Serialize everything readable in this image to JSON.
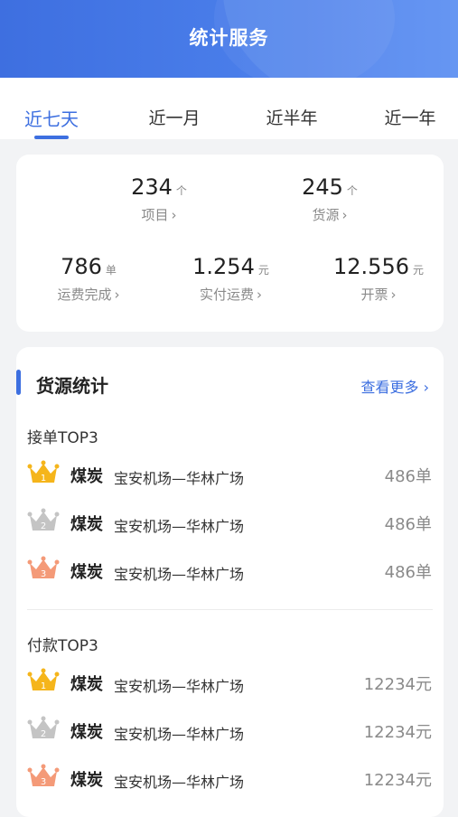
{
  "header": {
    "title": "统计服务"
  },
  "tabs": [
    {
      "label": "近七天",
      "active": true
    },
    {
      "label": "近一月",
      "active": false
    },
    {
      "label": "近半年",
      "active": false
    },
    {
      "label": "近一年",
      "active": false
    }
  ],
  "stats": {
    "projects": {
      "value": "234",
      "unit": "个",
      "label": "项目",
      "chevron": "›"
    },
    "sources": {
      "value": "245",
      "unit": "个",
      "label": "货源",
      "chevron": "›"
    },
    "freight_done": {
      "value": "786",
      "unit": "单",
      "label": "运费完成",
      "chevron": "›"
    },
    "paid_freight": {
      "value": "1.254",
      "unit": "元",
      "label": "实付运费",
      "chevron": "›"
    },
    "invoice": {
      "value": "12.556",
      "unit": "元",
      "label": "开票",
      "chevron": "›"
    }
  },
  "goods_stats": {
    "title": "货源统计",
    "more_label": "查看更多",
    "more_chevron": "›",
    "order_top": {
      "title": "接单TOP3",
      "rows": [
        {
          "rank": "1",
          "cargo": "煤炭",
          "route": "宝安机场—华林广场",
          "value": "486单"
        },
        {
          "rank": "2",
          "cargo": "煤炭",
          "route": "宝安机场—华林广场",
          "value": "486单"
        },
        {
          "rank": "3",
          "cargo": "煤炭",
          "route": "宝安机场—华林广场",
          "value": "486单"
        }
      ]
    },
    "payment_top": {
      "title": "付款TOP3",
      "rows": [
        {
          "rank": "1",
          "cargo": "煤炭",
          "route": "宝安机场—华林广场",
          "value": "12234元"
        },
        {
          "rank": "2",
          "cargo": "煤炭",
          "route": "宝安机场—华林广场",
          "value": "12234元"
        },
        {
          "rank": "3",
          "cargo": "煤炭",
          "route": "宝安机场—华林广场",
          "value": "12234元"
        }
      ]
    }
  },
  "colors": {
    "accent": "#3d6fe0",
    "gold": "#f5b51b",
    "silver": "#c4c4c4",
    "bronze": "#f49a78"
  },
  "icons": [
    "crown-gold-icon",
    "crown-silver-icon",
    "crown-bronze-icon",
    "chevron-right-icon"
  ]
}
